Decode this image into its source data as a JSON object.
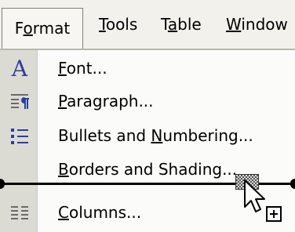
{
  "menubar": {
    "items": [
      {
        "label": "Format",
        "underline": "o",
        "active": true
      },
      {
        "label": "Tools",
        "underline": "T"
      },
      {
        "label": "Table",
        "underline": "a"
      },
      {
        "label": "Window",
        "underline": "W"
      }
    ]
  },
  "dropdown": {
    "items": [
      {
        "label": "Font...",
        "icon": "font-icon",
        "shortcut_letter": "F"
      },
      {
        "label": "Paragraph...",
        "icon": "paragraph-icon",
        "shortcut_letter": "P"
      },
      {
        "label": "Bullets and Numbering...",
        "icon": "bullets-numbering-icon",
        "shortcut_letter": "N"
      },
      {
        "label": "Borders and Shading...",
        "icon": null,
        "shortcut_letter": "B",
        "state": "being dragged"
      },
      {
        "label": "Columns...",
        "icon": "columns-icon",
        "shortcut_letter": "C"
      }
    ]
  },
  "drag": {
    "cursor": "move-copy-cursor",
    "indicator": "drop-insertion-line"
  },
  "colors": {
    "menubar_bg": "#f2f1ec",
    "gutter_bg": "#dcdbd3",
    "icon_blue": "#2a3fa0"
  }
}
